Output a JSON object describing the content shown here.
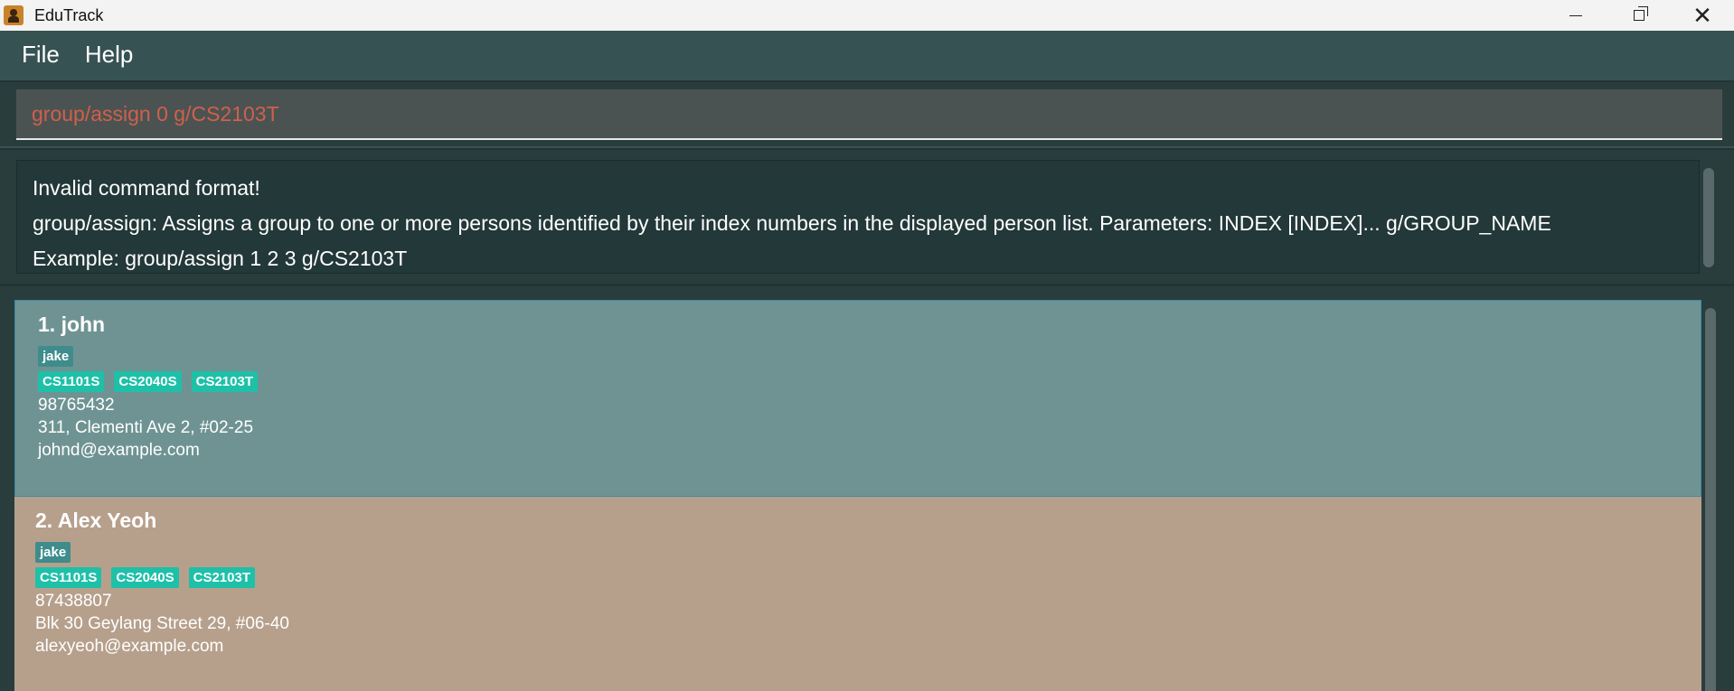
{
  "window": {
    "title": "EduTrack",
    "app_icon": "person-icon"
  },
  "menu": {
    "items": [
      {
        "label": "File"
      },
      {
        "label": "Help"
      }
    ]
  },
  "command": {
    "value": "group/assign 0 g/CS2103T",
    "error_color": "#d0604a"
  },
  "result": {
    "lines": [
      "Invalid command format!",
      "group/assign: Assigns a group to one or more persons identified by their index numbers in the displayed person list. Parameters: INDEX [INDEX]... g/GROUP_NAME",
      "Example: group/assign 1 2 3 g/CS2103T"
    ]
  },
  "persons": [
    {
      "name": "1. john",
      "alias_tags": [
        "jake"
      ],
      "group_tags": [
        "CS1101S",
        "CS2040S",
        "CS2103T"
      ],
      "phone": "98765432",
      "address": "311, Clementi Ave 2, #02-25",
      "email": "johnd@example.com",
      "selected": true
    },
    {
      "name": "2. Alex Yeoh",
      "alias_tags": [
        "jake"
      ],
      "group_tags": [
        "CS1101S",
        "CS2040S",
        "CS2103T"
      ],
      "phone": "87438807",
      "address": "Blk 30 Geylang Street 29, #06-40",
      "email": "alexyeoh@example.com",
      "selected": false
    }
  ],
  "colors": {
    "background": "#375252",
    "selected_card": "#6f9393",
    "card": "#b6a08c",
    "group_tag": "#1ec0a8",
    "alias_tag": "#3e8c8c"
  }
}
